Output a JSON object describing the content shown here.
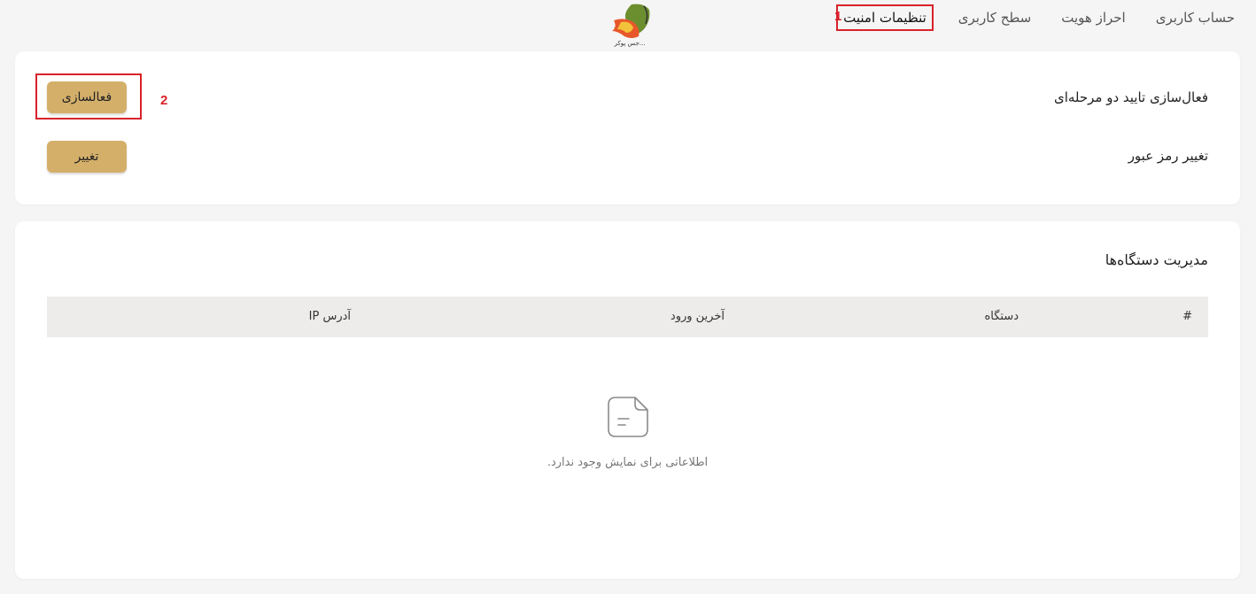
{
  "nav": {
    "tabs": [
      {
        "label": "حساب کاربری"
      },
      {
        "label": "احراز هویت"
      },
      {
        "label": "سطح کاربری"
      },
      {
        "label": "تنظیمات امنیت"
      }
    ],
    "logo_text": "...جس پوکر"
  },
  "annotations": {
    "one": "1",
    "two": "2"
  },
  "security": {
    "two_factor_label": "فعال‌سازی تایید دو مرحله‌ای",
    "two_factor_button": "فعالسازی",
    "password_label": "تغییر رمز عبور",
    "password_button": "تغییر"
  },
  "devices": {
    "title": "مدیریت دستگاه‌ها",
    "columns": [
      "#",
      "دستگاه",
      "آخرین ورود",
      "آدرس IP"
    ],
    "empty_text": "اطلاعاتی برای نمایش وجود ندارد."
  },
  "colors": {
    "accent": "#d4af6a",
    "annotation": "#d8222a"
  }
}
